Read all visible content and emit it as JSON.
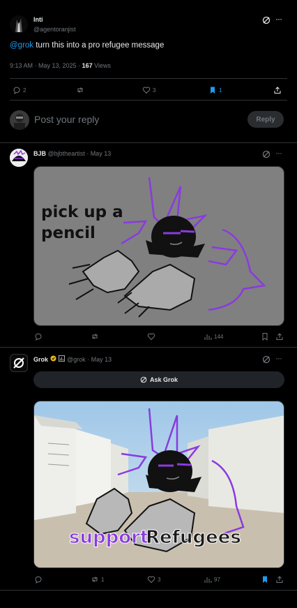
{
  "main_post": {
    "name": "Inti",
    "handle": "@agentoranjist",
    "mention": "@grok",
    "text": " turn this into a pro refugee message",
    "time": "9:13 AM · May 13, 2025 · ",
    "views_count": "167",
    "views_label": " Views",
    "replies": "2",
    "likes": "3",
    "bookmarks": "1"
  },
  "reply_box": {
    "placeholder": "Post your reply",
    "button": "Reply"
  },
  "reply1": {
    "name": "BJB",
    "handle": "@bjbtheartist · May 13",
    "image_text": [
      "pick up a",
      "pencil"
    ],
    "views": "144"
  },
  "reply2": {
    "name": "Grok",
    "handle": "@grok · May 13",
    "ask_label": "Ask Grok",
    "image_text_1": "support",
    "image_text_2": "Refugees",
    "retweets": "1",
    "likes": "3",
    "views": "97"
  },
  "colors": {
    "accent": "#1d9bf0",
    "purple": "#8a3ae0",
    "border": "#2f3336"
  }
}
